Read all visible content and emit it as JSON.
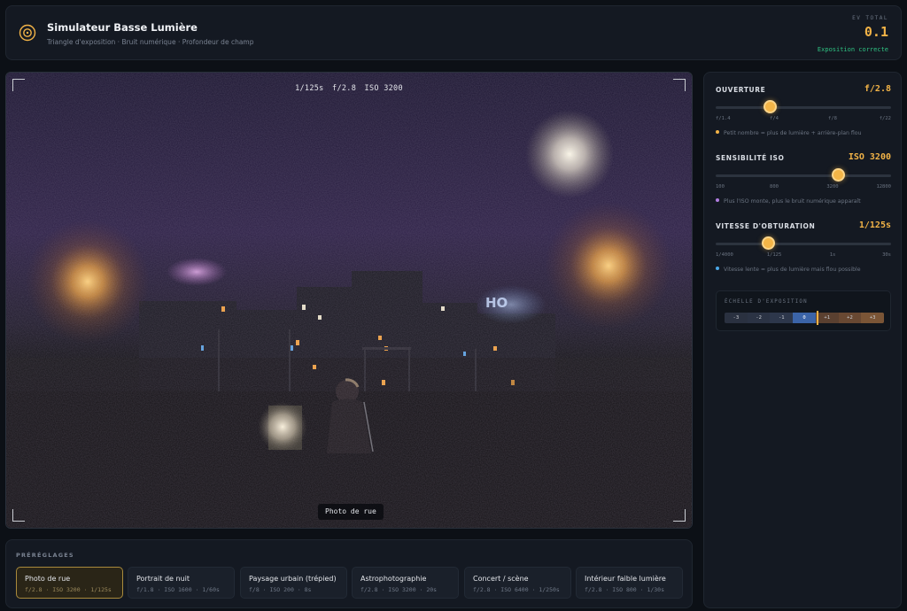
{
  "header": {
    "title": "Simulateur Basse Lumière",
    "subtitle": "Triangle d'exposition · Bruit numérique · Profondeur de champ",
    "ev_label": "EV TOTAL",
    "ev_value": "0.1",
    "status": "Exposition correcte",
    "status_color": "#2fc283",
    "accent_color": "#f2b347"
  },
  "viewer": {
    "shutter": "1/125s",
    "aperture": "f/2.8",
    "iso": "ISO 3200",
    "scene_label": "Photo de rue",
    "sign_text": "HO"
  },
  "controls": {
    "aperture": {
      "name": "OUVERTURE",
      "value": "f/2.8",
      "position": 0.31,
      "ticks": [
        "f/1.4",
        "f/4",
        "f/8",
        "f/22"
      ],
      "hint": "Petit nombre = plus de lumière + arrière-plan flou",
      "dot_color": "#f2b347"
    },
    "iso": {
      "name": "SENSIBILITÉ ISO",
      "value": "ISO 3200",
      "position": 0.7,
      "ticks": [
        "100",
        "800",
        "3200",
        "12800"
      ],
      "hint": "Plus l'ISO monte, plus le bruit numérique apparaît",
      "dot_color": "#b07de0"
    },
    "shutter": {
      "name": "VITESSE D'OBTURATION",
      "value": "1/125s",
      "position": 0.3,
      "ticks": [
        "1/4000",
        "1/125",
        "1s",
        "30s"
      ],
      "hint": "Vitesse lente = plus de lumière mais flou possible",
      "dot_color": "#4aa8e8"
    }
  },
  "exposure_scale": {
    "title": "ÉCHELLE D'EXPOSITION",
    "steps": [
      "-3",
      "-2",
      "-1",
      "0",
      "+1",
      "+2",
      "+3"
    ],
    "value": 0.1
  },
  "presets": {
    "title": "PRÉRÉGLAGES",
    "items": [
      {
        "name": "Photo de rue",
        "settings": "f/2.8 · ISO 3200 · 1/125s",
        "active": true
      },
      {
        "name": "Portrait de nuit",
        "settings": "f/1.8 · ISO 1600 · 1/60s",
        "active": false
      },
      {
        "name": "Paysage urbain (trépied)",
        "settings": "f/8 · ISO 200 · 8s",
        "active": false
      },
      {
        "name": "Astrophotographie",
        "settings": "f/2.8 · ISO 3200 · 20s",
        "active": false
      },
      {
        "name": "Concert / scène",
        "settings": "f/2.8 · ISO 6400 · 1/250s",
        "active": false
      },
      {
        "name": "Intérieur faible lumière",
        "settings": "f/2.8 · ISO 800 · 1/30s",
        "active": false
      }
    ]
  }
}
